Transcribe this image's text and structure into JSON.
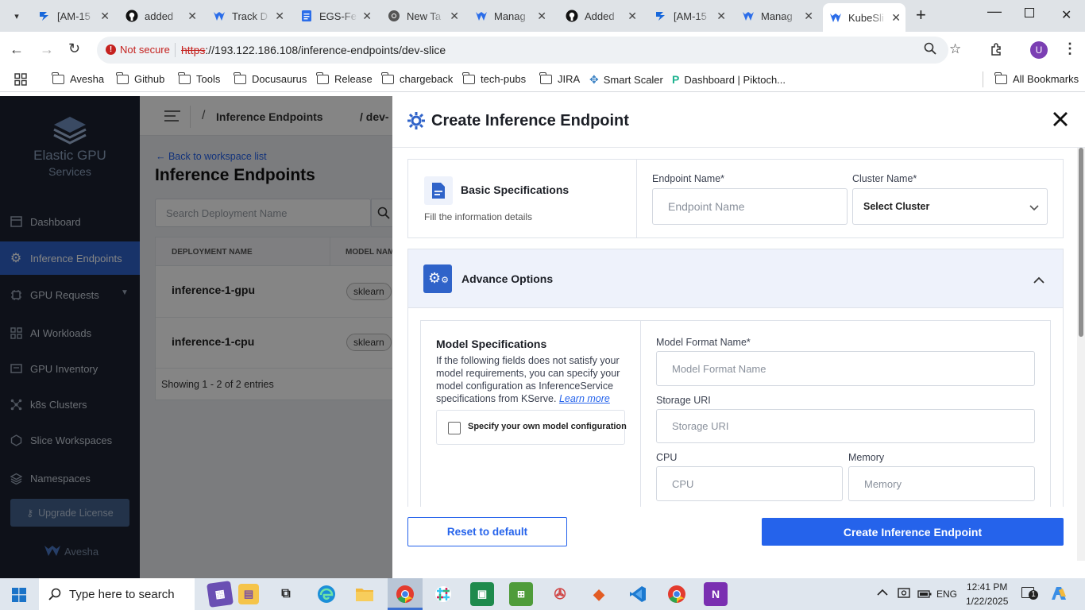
{
  "browser": {
    "tabs": [
      {
        "title": "[AM-15",
        "icon": "jira-icon",
        "color": "#1868db"
      },
      {
        "title": "added",
        "icon": "github-icon",
        "color": "#111111"
      },
      {
        "title": "Track D",
        "icon": "kubeslice-icon",
        "color": "#2b6de9"
      },
      {
        "title": "EGS-Fe",
        "icon": "docs-icon",
        "color": "#2b6de9"
      },
      {
        "title": "New Ta",
        "icon": "chrome-icon",
        "color": "#333333"
      },
      {
        "title": "Manag",
        "icon": "kubeslice-icon",
        "color": "#2b6de9"
      },
      {
        "title": "Added",
        "icon": "github-icon",
        "color": "#111111"
      },
      {
        "title": "[AM-15",
        "icon": "jira-icon",
        "color": "#1868db"
      },
      {
        "title": "Manag",
        "icon": "kubeslice-icon",
        "color": "#2b6de9"
      },
      {
        "title": "KubeSli",
        "icon": "kubeslice-icon",
        "color": "#2b6de9"
      }
    ],
    "security_label": "Not secure",
    "url_scheme": "https",
    "url_rest": "://193.122.186.108/inference-endpoints/dev-slice",
    "profile_initial": "U",
    "bookmarks": [
      "Avesha",
      "Github",
      "Tools",
      "Docusaurus",
      "Release",
      "chargeback",
      "tech-pubs",
      "JIRA",
      "Smart Scaler",
      "Dashboard | Piktoch..."
    ],
    "all_bookmarks": "All Bookmarks"
  },
  "sidebar": {
    "product_name": "Elastic GPU",
    "product_sub": "Services",
    "items": [
      {
        "label": "Dashboard",
        "icon": "dashboard-icon"
      },
      {
        "label": "Inference Endpoints",
        "icon": "gear-icon"
      },
      {
        "label": "GPU Requests",
        "icon": "gpu-icon"
      },
      {
        "label": "AI Workloads",
        "icon": "workloads-icon"
      },
      {
        "label": "GPU Inventory",
        "icon": "inventory-icon"
      },
      {
        "label": "k8s Clusters",
        "icon": "clusters-icon"
      },
      {
        "label": "Slice Workspaces",
        "icon": "slice-icon"
      },
      {
        "label": "Namespaces",
        "icon": "namespaces-icon"
      }
    ],
    "upgrade": "Upgrade License",
    "brand": "Avesha"
  },
  "page": {
    "breadcrumb_sep": "/",
    "breadcrumb": "Inference Endpoints",
    "breadcrumb2": "/ dev-",
    "back": "← Back to workspace list",
    "title": "Inference Endpoints",
    "search_placeholder": "Search Deployment Name",
    "columns": [
      "DEPLOYMENT NAME",
      "MODEL NAME"
    ],
    "rows": [
      {
        "name": "inference-1-gpu",
        "model": "sklearn"
      },
      {
        "name": "inference-1-cpu",
        "model": "sklearn"
      }
    ],
    "footer": "Showing 1 - 2 of 2 entries"
  },
  "drawer": {
    "title": "Create Inference Endpoint",
    "basic": {
      "title": "Basic Specifications",
      "subtitle": "Fill the information details"
    },
    "endpoint_label": "Endpoint Name*",
    "endpoint_placeholder": "Endpoint Name",
    "cluster_label": "Cluster Name*",
    "cluster_value": "Select Cluster",
    "advance_title": "Advance Options",
    "model_spec_title": "Model Specifications",
    "model_spec_desc": "If the following fields does not satisfy your model requirements, you can specify your model configuration as InferenceService specifications from KServe.",
    "learn_more": "Learn more",
    "checkbox_label": "Specify your own model configuration",
    "model_format_label": "Model Format Name*",
    "model_format_placeholder": "Model Format Name",
    "storage_label": "Storage URI",
    "storage_placeholder": "Storage URI",
    "cpu_label": "CPU",
    "cpu_placeholder": "CPU",
    "memory_label": "Memory",
    "memory_placeholder": "Memory",
    "reset": "Reset to default",
    "create": "Create Inference Endpoint"
  },
  "taskbar": {
    "search_placeholder": "Type here to search",
    "language": "ENG",
    "time": "12:41 PM",
    "date": "1/22/2025",
    "notification_count": "1"
  },
  "colors": {
    "accent": "#2563eb",
    "sidebar_bg": "#1c2230",
    "active_nav": "#2f63c9",
    "panel_bg": "#eef2fb"
  }
}
